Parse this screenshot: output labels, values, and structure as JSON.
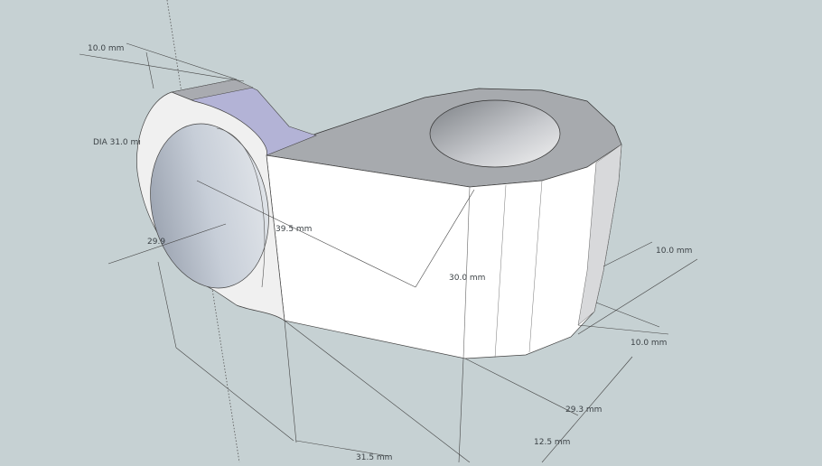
{
  "colors": {
    "background": "#c6d1d3",
    "face": "#ffffff",
    "top_face": "#a7aaae",
    "ring_top": "#b3b3d6",
    "lines": "#3c4246"
  },
  "dimensions": {
    "ring_width": "10.0 mm",
    "ring_diameter": "DIA 31.0 mm",
    "ring_height": "29.9",
    "diagonal": "39.5 mm",
    "block_height": "30.0 mm",
    "right_width": "10.0 mm",
    "right_depth": "10.0 mm",
    "base_length": "29.3 mm",
    "base_offset": "12.5 mm",
    "total_length": "31.5 mm"
  }
}
